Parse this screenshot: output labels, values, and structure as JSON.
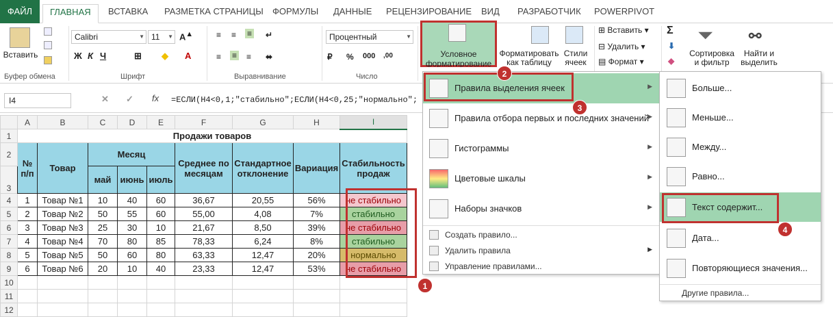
{
  "tabs": [
    "ФАЙЛ",
    "ГЛАВНАЯ",
    "ВСТАВКА",
    "РАЗМЕТКА СТРАНИЦЫ",
    "ФОРМУЛЫ",
    "ДАННЫЕ",
    "РЕЦЕНЗИРОВАНИЕ",
    "ВИД",
    "РАЗРАБОТЧИК",
    "POWERPIVOT"
  ],
  "ribbon": {
    "paste": "Вставить",
    "clipboard_group": "Буфер обмена",
    "font_name": "Calibri",
    "font_size": "11",
    "font_group": "Шрифт",
    "align_group": "Выравнивание",
    "number_format": "Процентный",
    "number_group": "Число",
    "cond_format_1": "Условное",
    "cond_format_2": "форматирование",
    "format_table_1": "Форматировать",
    "format_table_2": "как таблицу",
    "styles_1": "Стили",
    "styles_2": "ячеек",
    "insert": "Вставить",
    "delete": "Удалить",
    "format": "Формат",
    "sort_1": "Сортировка",
    "sort_2": "и фильтр",
    "find_1": "Найти и",
    "find_2": "выделить"
  },
  "formula_bar": {
    "cell": "I4",
    "fx": "fx",
    "formula": "=ЕСЛИ(H4<0,1;\"стабильно\";ЕСЛИ(H4<0,25;\"нормально\";"
  },
  "sheet": {
    "columns": [
      "A",
      "B",
      "C",
      "D",
      "E",
      "F",
      "G",
      "H",
      "I"
    ],
    "title": "Продажи товаров",
    "headers": {
      "num": "№ п/п",
      "product": "Товар",
      "month": "Месяц",
      "may": "май",
      "june": "июнь",
      "july": "июль",
      "avg": "Среднее по месяцам",
      "std": "Стандартное отклонение",
      "var": "Вариация",
      "stab": "Стабильность продаж"
    },
    "rows": [
      {
        "n": "1",
        "p": "Товар №1",
        "c": "10",
        "d": "40",
        "e": "60",
        "f": "36,67",
        "g": "20,55",
        "h": "56%",
        "i": "не стабильно",
        "s": "red"
      },
      {
        "n": "2",
        "p": "Товар №2",
        "c": "50",
        "d": "55",
        "e": "60",
        "f": "55,00",
        "g": "4,08",
        "h": "7%",
        "i": "стабильно",
        "s": "grn"
      },
      {
        "n": "3",
        "p": "Товар №3",
        "c": "25",
        "d": "30",
        "e": "10",
        "f": "21,67",
        "g": "8,50",
        "h": "39%",
        "i": "не стабильно",
        "s": "redb"
      },
      {
        "n": "4",
        "p": "Товар №4",
        "c": "70",
        "d": "80",
        "e": "85",
        "f": "78,33",
        "g": "6,24",
        "h": "8%",
        "i": "стабильно",
        "s": "grn"
      },
      {
        "n": "5",
        "p": "Товар №5",
        "c": "50",
        "d": "60",
        "e": "80",
        "f": "63,33",
        "g": "12,47",
        "h": "20%",
        "i": "нормально",
        "s": "yel"
      },
      {
        "n": "6",
        "p": "Товар №6",
        "c": "20",
        "d": "10",
        "e": "40",
        "f": "23,33",
        "g": "12,47",
        "h": "53%",
        "i": "не стабильно",
        "s": "redb"
      }
    ]
  },
  "menu": {
    "items": [
      "Правила выделения ячеек",
      "Правила отбора первых и последних значений",
      "Гистограммы",
      "Цветовые шкалы",
      "Наборы значков"
    ],
    "small": [
      "Создать правило...",
      "Удалить правила",
      "Управление правилами..."
    ]
  },
  "submenu": {
    "items": [
      "Больше...",
      "Меньше...",
      "Между...",
      "Равно...",
      "Текст содержит...",
      "Дата...",
      "Повторяющиеся значения..."
    ],
    "other": "Другие правила..."
  },
  "badges": [
    "1",
    "2",
    "3",
    "4"
  ],
  "colors": {
    "accent": "#217346",
    "highlight": "#9fd5b1",
    "marker": "#c0312f"
  }
}
